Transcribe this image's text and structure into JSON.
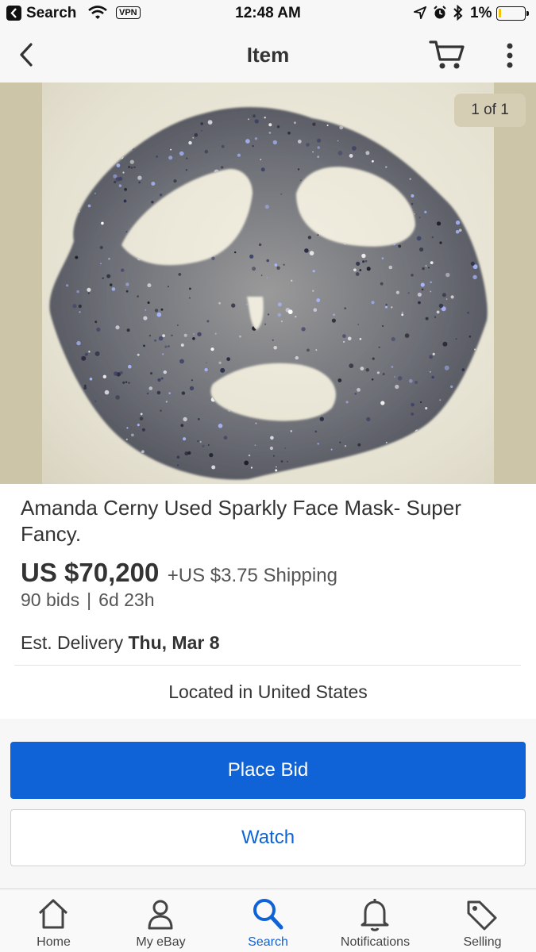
{
  "status_bar": {
    "back_app": "Search",
    "vpn": "VPN",
    "time": "12:48 AM",
    "battery": "1%",
    "battery_level_percent": 1
  },
  "nav": {
    "title": "Item",
    "back_icon": "chevron-left-icon",
    "cart_icon": "cart-icon",
    "more_icon": "more-vertical-icon"
  },
  "gallery": {
    "counter": "1 of 1"
  },
  "item": {
    "title": "Amanda Cerny Used Sparkly Face Mask- Super Fancy.",
    "price": "US $70,200",
    "shipping": "+US $3.75 Shipping",
    "bids": "90 bids",
    "separator": "|",
    "time_left": "6d 23h",
    "delivery_label": "Est. Delivery",
    "delivery_date": "Thu, Mar 8",
    "location": "Located in United States"
  },
  "actions": {
    "place_bid": "Place Bid",
    "watch": "Watch"
  },
  "tabs": [
    {
      "label": "Home",
      "icon": "home-icon",
      "active": false
    },
    {
      "label": "My eBay",
      "icon": "person-icon",
      "active": false
    },
    {
      "label": "Search",
      "icon": "search-icon",
      "active": true
    },
    {
      "label": "Notifications",
      "icon": "bell-icon",
      "active": false
    },
    {
      "label": "Selling",
      "icon": "tag-icon",
      "active": false
    }
  ],
  "colors": {
    "accent": "#0f63d6",
    "text": "#333333",
    "secondary_text": "#555555",
    "image_background": "#cdc5a8"
  }
}
